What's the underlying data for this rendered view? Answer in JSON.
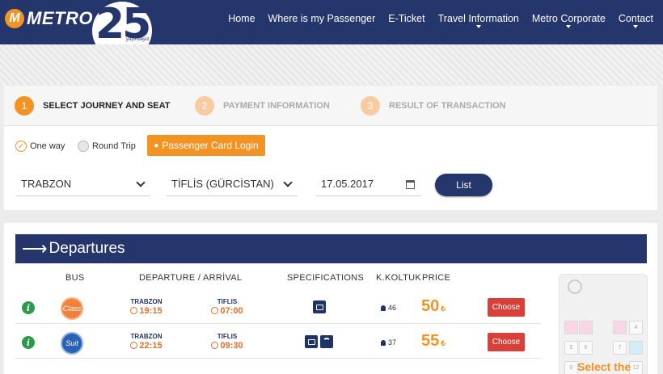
{
  "brand": {
    "name": "METRO",
    "anniversary_number": "25",
    "anniversary_sub": "yaşındayız"
  },
  "nav": {
    "items": [
      "Home",
      "Where is my Passenger",
      "E-Ticket",
      "Travel Information",
      "Metro Corporate",
      "Contact"
    ]
  },
  "steps": [
    {
      "num": "1",
      "label": "SELECT JOURNEY AND SEAT"
    },
    {
      "num": "2",
      "label": "PAYMENT INFORMATION"
    },
    {
      "num": "3",
      "label": "RESULT OF TRANSACTION"
    }
  ],
  "search": {
    "one_way_label": "One way",
    "round_trip_label": "Round Trip",
    "trip_type_selected": "One way",
    "passenger_card_label": "Passenger Card Login",
    "from": "TRABZON",
    "to": "TİFLİS (GÜRCİSTAN)",
    "date": "17.05.2017",
    "list_label": "List"
  },
  "departures": {
    "title": "Departures",
    "headers": {
      "bus": "BUS",
      "dep_arr": "DEPARTURE / ARRİVAL",
      "specs": "SPECIFICATIONS",
      "seats": "K.KOLTUK",
      "price": "PRICE"
    },
    "rows": [
      {
        "bus": "Class",
        "from_city": "TRABZON",
        "dep_time": "19:15",
        "to_city": "TIFLIS",
        "arr_time": "07:00",
        "seats": "46",
        "price": "50",
        "currency": "₺",
        "choose": "Choose"
      },
      {
        "bus": "Suit",
        "from_city": "TRABZON",
        "dep_time": "22:15",
        "to_city": "TIFLIS",
        "arr_time": "09:30",
        "seats": "37",
        "price": "55",
        "currency": "₺",
        "choose": "Choose"
      }
    ]
  },
  "seatmap": {
    "hint": "Select the",
    "seat_numbers": [
      "4",
      "5",
      "6",
      "7",
      "9",
      "12"
    ]
  },
  "colors": {
    "navy": "#24366b",
    "orange": "#f39323",
    "red": "#d9403a",
    "green": "#2b9a4a"
  }
}
